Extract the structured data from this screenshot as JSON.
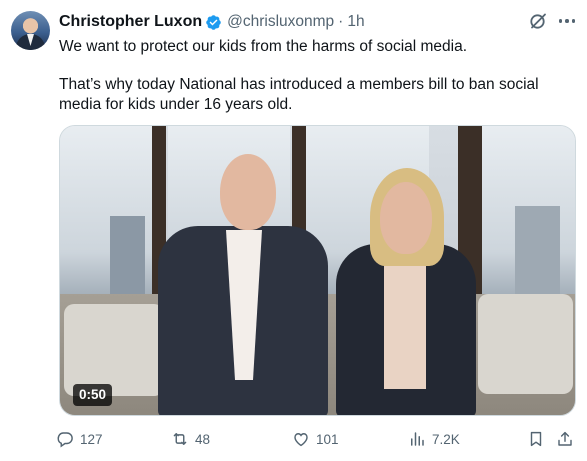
{
  "post": {
    "author_name": "Christopher Luxon",
    "handle": "@chrisluxonmp",
    "separator": "·",
    "time": "1h",
    "text_line1": "We want to protect our kids from the harms of social media.",
    "text_line2": "That’s why today National has introduced a members bill to ban social media for kids under 16 years old."
  },
  "media": {
    "duration": "0:50"
  },
  "actions": {
    "replies": "127",
    "reposts": "48",
    "likes": "101",
    "views": "7.2K"
  },
  "icons": {
    "verified": "verified-badge-icon",
    "grok": "grok-icon",
    "more": "more-icon",
    "reply": "reply-icon",
    "repost": "repost-icon",
    "like": "heart-icon",
    "views": "views-chart-icon",
    "bookmark": "bookmark-icon",
    "share": "share-icon"
  },
  "colors": {
    "text": "#0f1419",
    "secondary": "#536471",
    "verified": "#1d9bf0"
  }
}
